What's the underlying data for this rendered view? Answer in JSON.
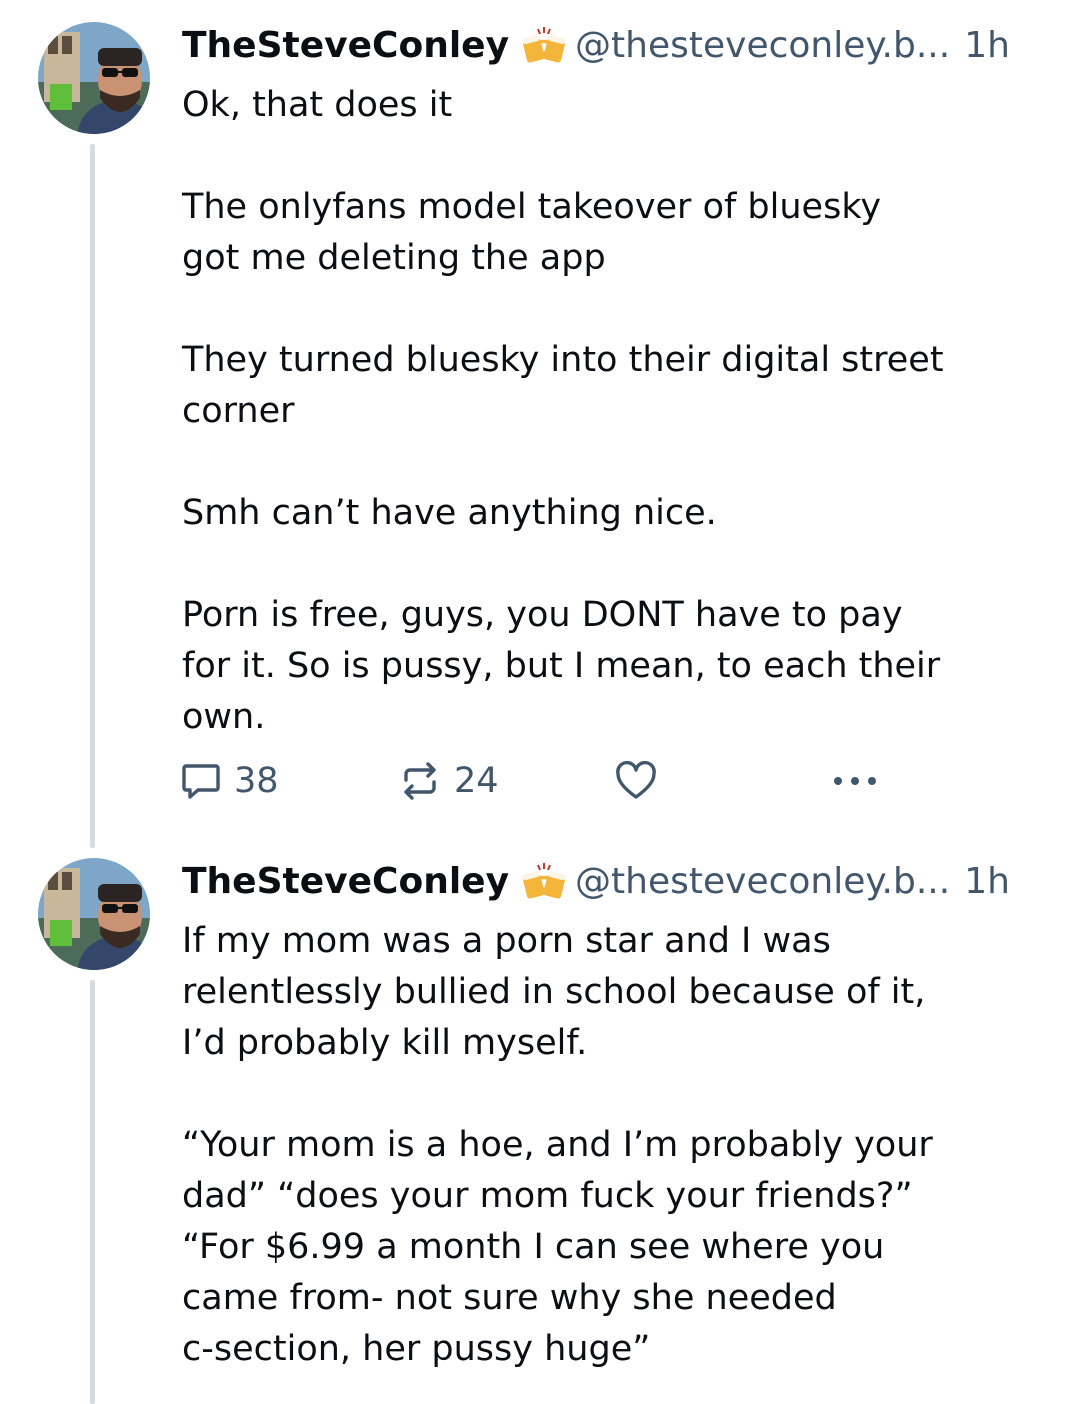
{
  "posts": [
    {
      "author": {
        "display_name": "TheSteveConley",
        "handle": "@thesteveconley.b...",
        "badge_icon": "beer-mugs-icon"
      },
      "timestamp": "1h",
      "lines": [
        "Ok, that does it",
        "",
        "The onlyfans model takeover of bluesky",
        "got me deleting the app",
        "",
        "They turned bluesky into their digital street",
        "corner",
        "",
        "Smh can’t have anything nice.",
        "",
        "Porn is free, guys, you DONT have to pay",
        "for it. So is pussy, but I mean, to each their",
        "own."
      ],
      "actions": {
        "reply_count": "38",
        "repost_count": "24"
      }
    },
    {
      "author": {
        "display_name": "TheSteveConley",
        "handle": "@thesteveconley.b...",
        "badge_icon": "beer-mugs-icon"
      },
      "timestamp": "1h",
      "lines": [
        "If my mom was a porn star and I was",
        "relentlessly bullied in school because of it,",
        "I’d probably kill myself.",
        "",
        "“Your mom is a hoe, and I’m probably your",
        "dad” “does your mom fuck your friends?”",
        "“For $6.99 a month I can see where you",
        "came from- not sure why she needed",
        "c-section, her pussy huge”"
      ]
    }
  ],
  "colors": {
    "text": "#0b0f14",
    "muted": "#42576c",
    "thread_line": "#d4dbe2"
  }
}
